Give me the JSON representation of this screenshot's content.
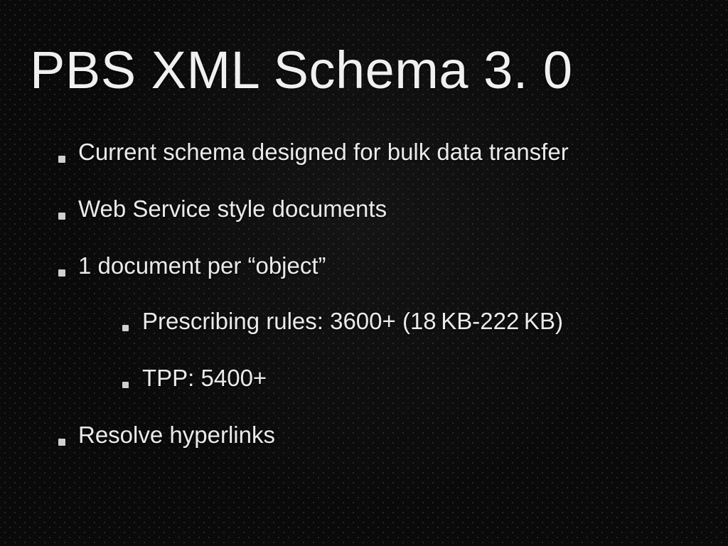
{
  "title": "PBS XML Schema 3. 0",
  "bullets": {
    "b1": "Current schema designed for bulk data transfer",
    "b2": "Web Service style documents",
    "b3": "1 document per “object”",
    "b3_sub1": "Prescribing rules: 3600+ (18 KB-222 KB)",
    "b3_sub2": "TPP: 5400+",
    "b4": "Resolve hyperlinks"
  }
}
